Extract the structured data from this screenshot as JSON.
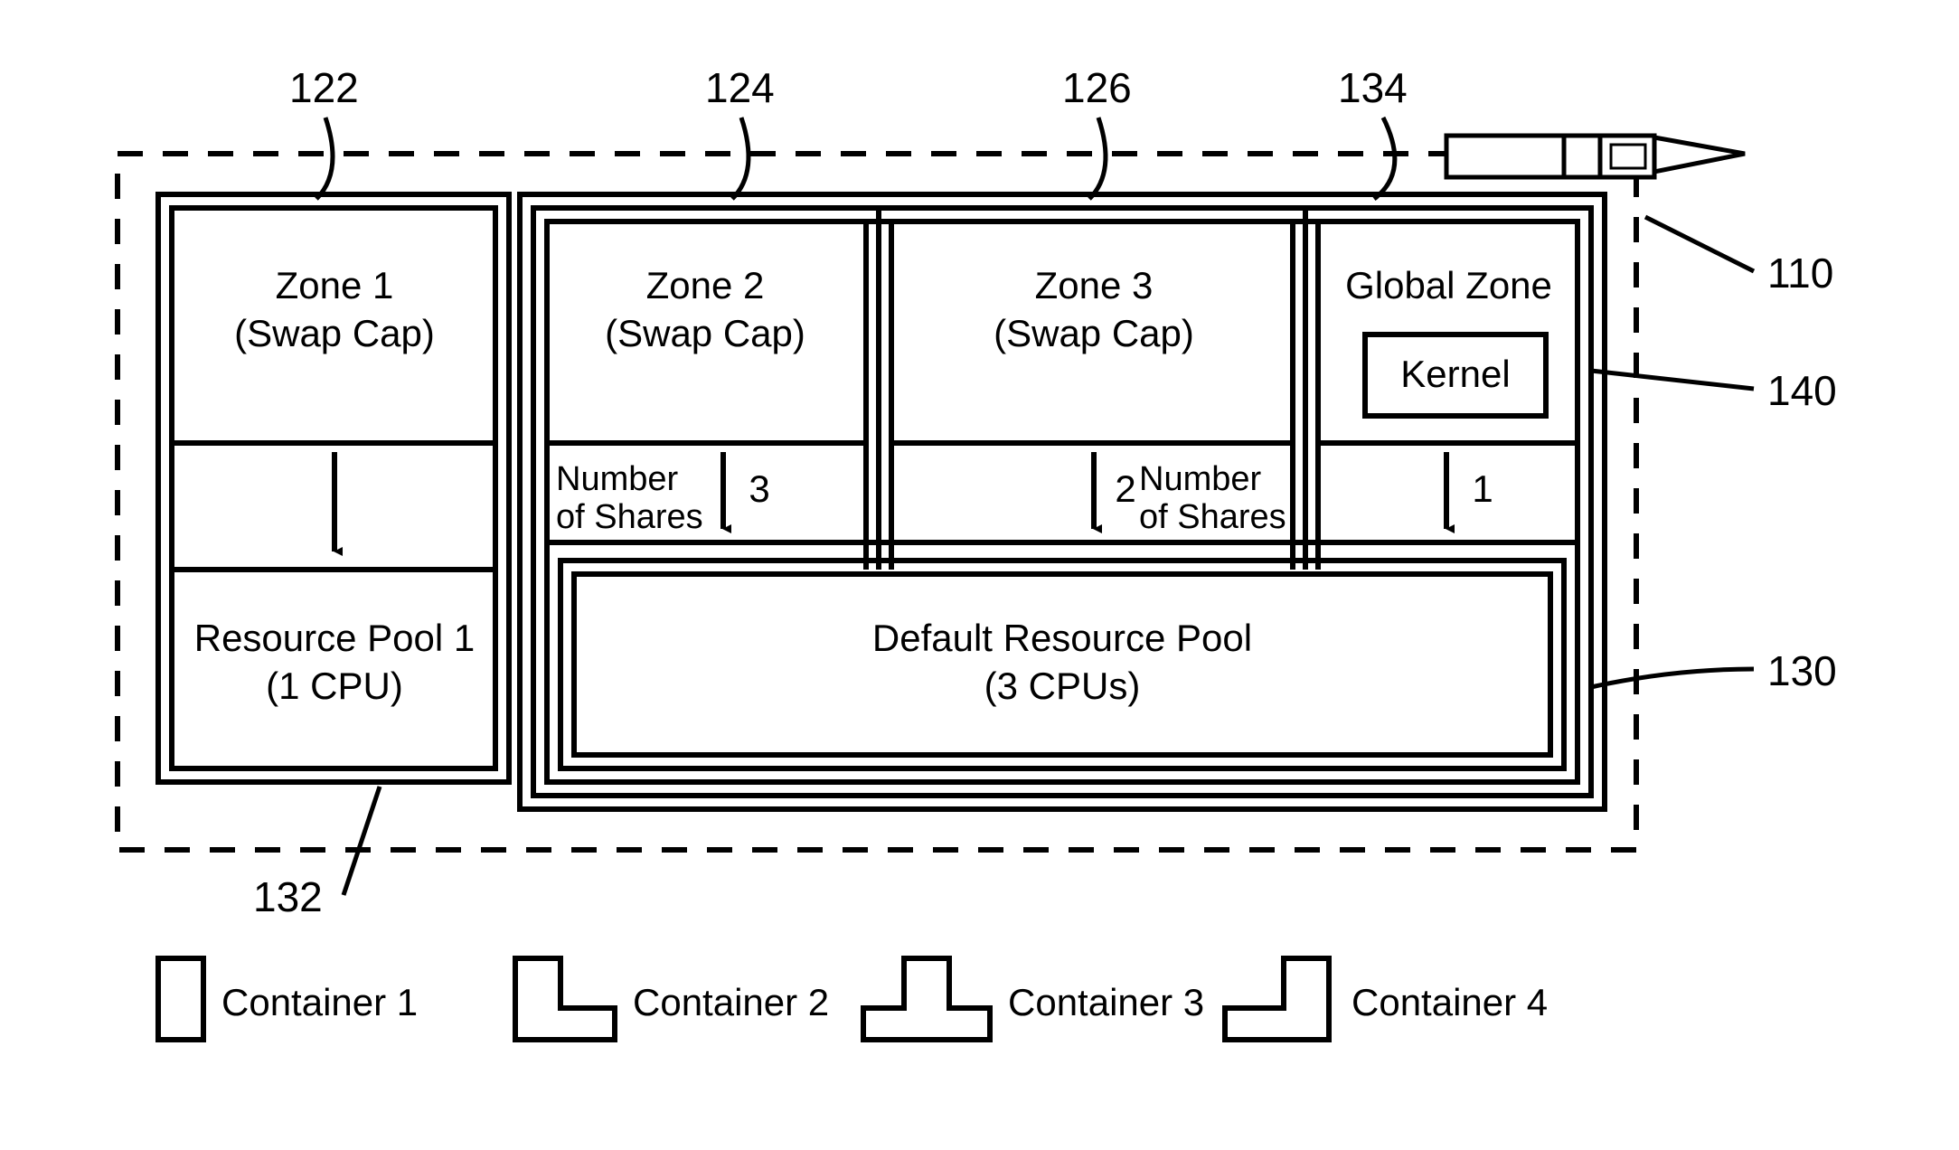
{
  "refs": {
    "r110": "110",
    "r122": "122",
    "r124": "124",
    "r126": "126",
    "r130": "130",
    "r132": "132",
    "r134": "134",
    "r140": "140"
  },
  "zones": {
    "z1_l1": "Zone 1",
    "z1_l2": "(Swap Cap)",
    "z2_l1": "Zone 2",
    "z2_l2": "(Swap Cap)",
    "z3_l1": "Zone 3",
    "z3_l2": "(Swap Cap)",
    "global": "Global Zone",
    "kernel": "Kernel"
  },
  "shares": {
    "label_l1": "Number",
    "label_l2": "of Shares",
    "v2": "3",
    "v3": "2",
    "v4": "1"
  },
  "pools": {
    "p1_l1": "Resource Pool 1",
    "p1_l2": "(1 CPU)",
    "def_l1": "Default Resource Pool",
    "def_l2": "(3 CPUs)"
  },
  "legend": {
    "c1": "Container 1",
    "c2": "Container 2",
    "c3": "Container 3",
    "c4": "Container 4"
  }
}
